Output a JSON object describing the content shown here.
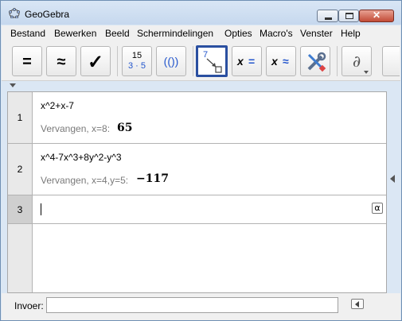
{
  "window": {
    "title": "GeoGebra"
  },
  "menu": [
    "Bestand",
    "Bewerken",
    "Beeld",
    "Schermindelingen",
    "Opties",
    "Macro's",
    "Venster",
    "Help"
  ],
  "toolbar": {
    "evaluate": "=",
    "numeric": "≈",
    "keep_input": "✓",
    "factor_top": "15",
    "factor_bottom": "3 · 5",
    "expand": "(())",
    "substitute_top": "7",
    "solve_x": "x",
    "solve_eq": "=",
    "nsolve_x": "x",
    "nsolve_eq": "≈",
    "derivative": "∂"
  },
  "cas": {
    "rows": [
      {
        "number": "1",
        "input": "x^2+x-7",
        "output_label": "Vervangen, x=8:",
        "output_value": "65"
      },
      {
        "number": "2",
        "input": "x^4-7x^3+8y^2-y^3",
        "output_label": "Vervangen, x=4,y=5:",
        "output_value": "−117"
      },
      {
        "number": "3",
        "input": "",
        "symbol_button": "α"
      }
    ]
  },
  "inputbar": {
    "label": "Invoer:",
    "value": ""
  }
}
